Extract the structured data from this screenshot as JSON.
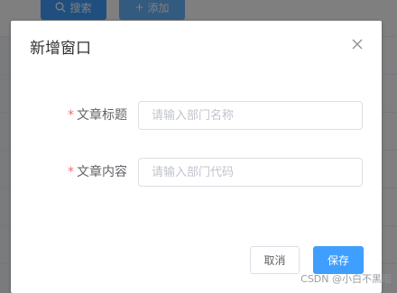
{
  "background": {
    "toolbar": {
      "search_label": "搜索",
      "add_label": "添加"
    }
  },
  "dialog": {
    "title": "新增窗口",
    "fields": [
      {
        "label": "文章标题",
        "required_mark": "*",
        "placeholder": "请输入部门名称",
        "value": ""
      },
      {
        "label": "文章内容",
        "required_mark": "*",
        "placeholder": "请输入部门代码",
        "value": ""
      }
    ],
    "buttons": {
      "cancel_label": "取消",
      "save_label": "保存"
    }
  },
  "watermark": "CSDN @小白不黑哦",
  "colors": {
    "primary": "#409eff",
    "required": "#f56c6c",
    "mask": "rgba(0,0,0,0.5)"
  }
}
